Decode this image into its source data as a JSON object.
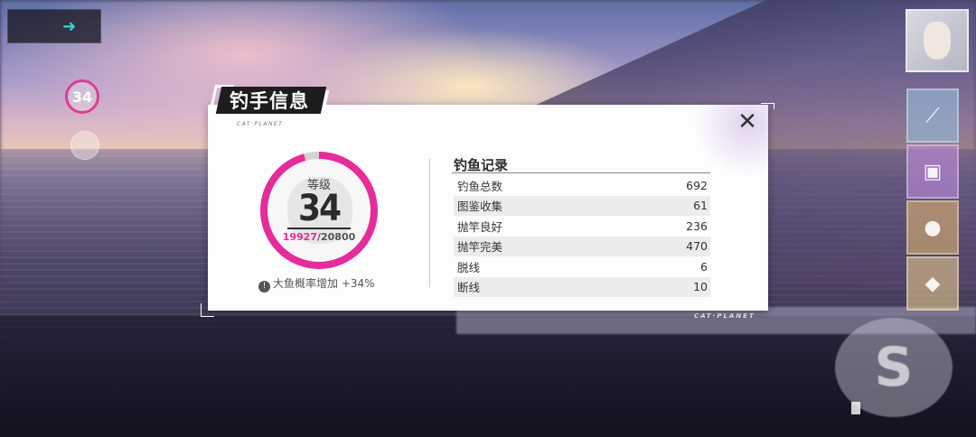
{
  "modal": {
    "title": "钓手信息",
    "brand": "CAT·PLANET",
    "close_glyph": "✕"
  },
  "level": {
    "label": "等级",
    "value": "34",
    "exp_current": "19927",
    "exp_total": "/20800",
    "progress_fraction": 0.958
  },
  "bonus": {
    "icon": "info-icon",
    "text": "大鱼概率增加 +34%"
  },
  "records": {
    "title": "钓鱼记录",
    "rows": [
      {
        "label": "钓鱼总数",
        "value": "692"
      },
      {
        "label": "图鉴收集",
        "value": "61"
      },
      {
        "label": "抛竿良好",
        "value": "236"
      },
      {
        "label": "抛竿完美",
        "value": "470"
      },
      {
        "label": "脱线",
        "value": "6"
      },
      {
        "label": "断线",
        "value": "10"
      }
    ]
  },
  "hud": {
    "level_badge": "34",
    "brand_bottom": "CAT·PLANET"
  },
  "colors": {
    "accent_pink": "#e62b9a",
    "ring_track": "#d3d3d3",
    "title_bg": "#1d1d1f"
  }
}
